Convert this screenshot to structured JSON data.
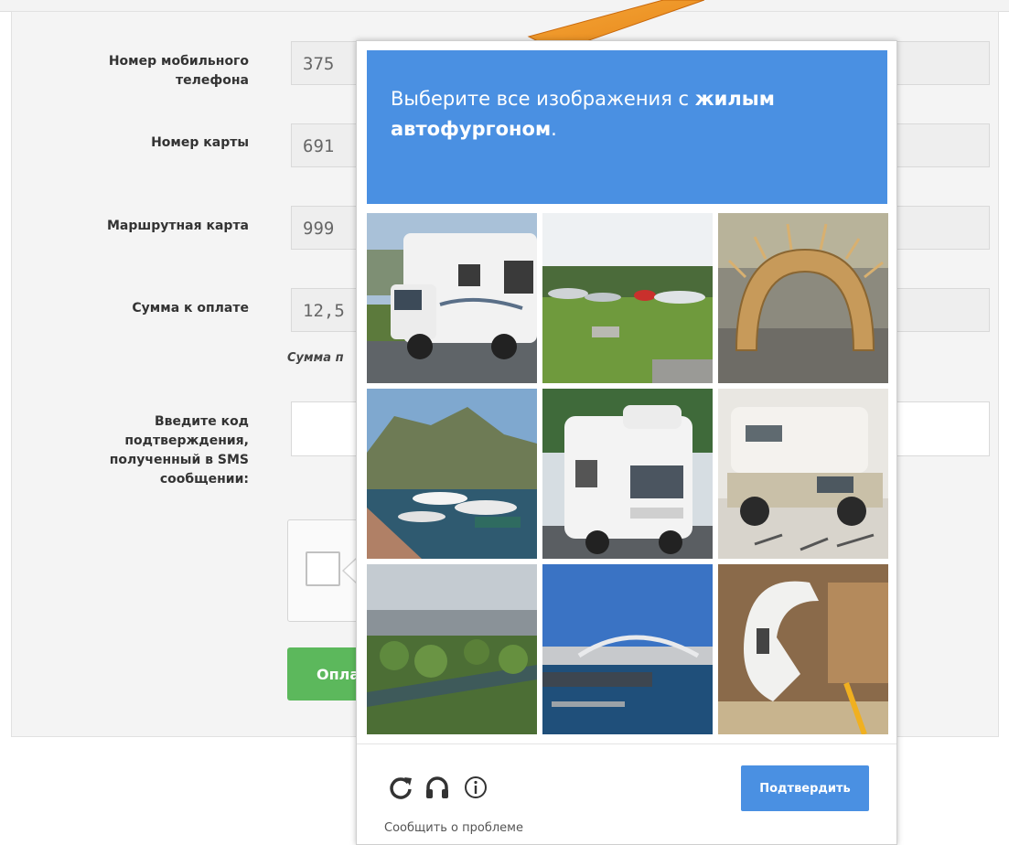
{
  "form": {
    "phone": {
      "label": "Номер мобильного телефона",
      "value": "375"
    },
    "card": {
      "label": "Номер карты",
      "value": "691"
    },
    "route_card": {
      "label": "Маршрутная карта",
      "value": "999"
    },
    "amount": {
      "label": "Сумма к оплате",
      "value": "12,5",
      "hint": "Сумма п"
    },
    "sms_code": {
      "label": "Введите код подтверждения, полученный в SMS сообщении:",
      "value": ""
    },
    "pay_button": {
      "label": "Опла"
    }
  },
  "challenge": {
    "prompt_prefix": "Выберите все изображения с ",
    "prompt_target": "жилым автофургоном",
    "prompt_suffix": ".",
    "tiles": [
      {
        "name": "tile-1",
        "content": "camper-van"
      },
      {
        "name": "tile-2",
        "content": "airfield-with-jets"
      },
      {
        "name": "tile-3",
        "content": "wooden-arch-sculpture"
      },
      {
        "name": "tile-4",
        "content": "marina-with-boats"
      },
      {
        "name": "tile-5",
        "content": "camper-van"
      },
      {
        "name": "tile-6",
        "content": "truck-camper"
      },
      {
        "name": "tile-7",
        "content": "river-park-aerial"
      },
      {
        "name": "tile-8",
        "content": "harbor-bridge"
      },
      {
        "name": "tile-9",
        "content": "white-machine-closeup"
      }
    ],
    "verify_label": "Подтвердить",
    "report_label": "Сообщить о проблеме",
    "icons": [
      "refresh-icon",
      "headphones-icon",
      "info-icon"
    ]
  },
  "colors": {
    "challenge_blue": "#4a90e2",
    "pay_green": "#5cb85c",
    "arrow_orange": "#f39a1e"
  }
}
